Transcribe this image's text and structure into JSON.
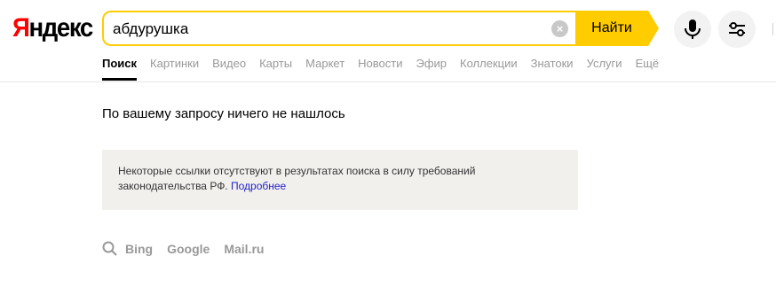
{
  "logo": {
    "first_letter": "Я",
    "rest": "ндекс"
  },
  "search": {
    "value": "абдурушка",
    "clear_label": "×",
    "button_label": "Найти"
  },
  "tabs": [
    {
      "label": "Поиск",
      "active": true
    },
    {
      "label": "Картинки"
    },
    {
      "label": "Видео"
    },
    {
      "label": "Карты"
    },
    {
      "label": "Маркет"
    },
    {
      "label": "Новости"
    },
    {
      "label": "Эфир"
    },
    {
      "label": "Коллекции"
    },
    {
      "label": "Знатоки"
    },
    {
      "label": "Услуги"
    },
    {
      "label": "Ещё"
    }
  ],
  "results": {
    "no_results_text": "По вашему запросу ничего не нашлось"
  },
  "notice": {
    "text": "Некоторые ссылки отсутствуют в результатах поиска в силу требований законодательства РФ.",
    "link_label": "Подробнее"
  },
  "other_engines": [
    "Bing",
    "Google",
    "Mail.ru"
  ],
  "icons": {
    "mic": "microphone-icon",
    "filter": "filter-settings-icon",
    "search": "search-icon",
    "clear": "clear-icon"
  },
  "colors": {
    "accent": "#ffcc00",
    "logo_red": "#ff0000",
    "link": "#2222cc",
    "notice_bg": "#f2f0ed"
  }
}
